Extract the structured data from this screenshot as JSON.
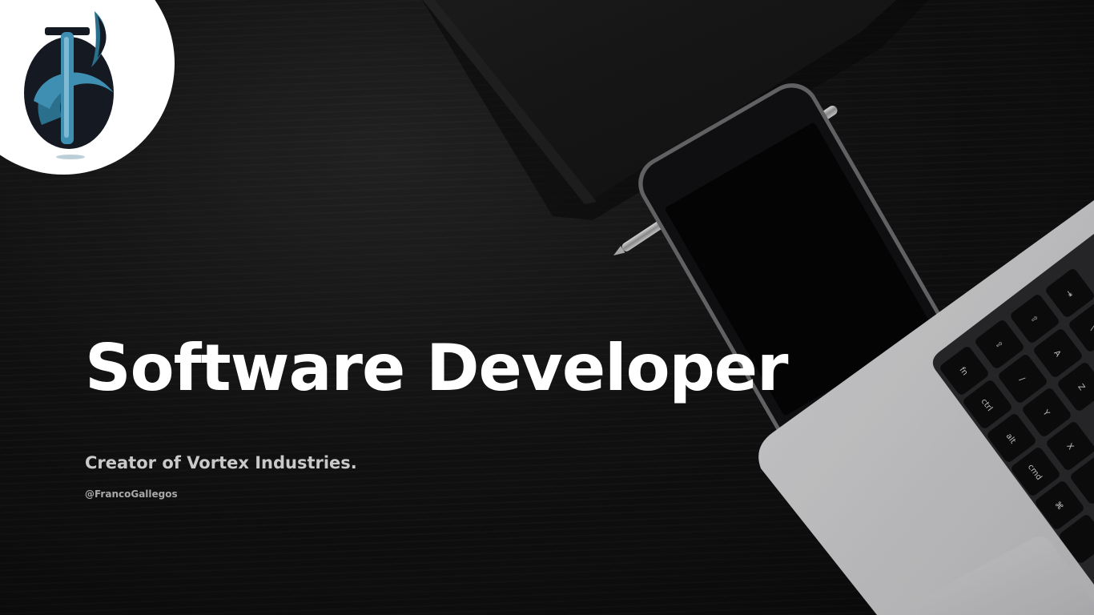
{
  "hero": {
    "title": "Software Developer",
    "subtitle": "Creator of Vortex Industries.",
    "handle": "@FrancoGallegos"
  },
  "logo": {
    "icon": "vortex-industries-logo-icon"
  },
  "keyboard": {
    "key_labels": [
      "fn",
      "ctrl",
      "alt",
      "cmd",
      "⌘",
      "⇪",
      "⇧",
      "A",
      "Z",
      "X",
      "Y",
      "⇥",
      "/",
      "\\"
    ]
  },
  "colors": {
    "background": "#0b0b0b",
    "title": "#ffffff",
    "subtitle": "#c9c9c9",
    "handle": "#a8a8a8",
    "logo_badge": "#ffffff",
    "logo_dark": "#141922",
    "logo_teal": "#2a6f8c",
    "logo_blue": "#3f8fb3"
  }
}
